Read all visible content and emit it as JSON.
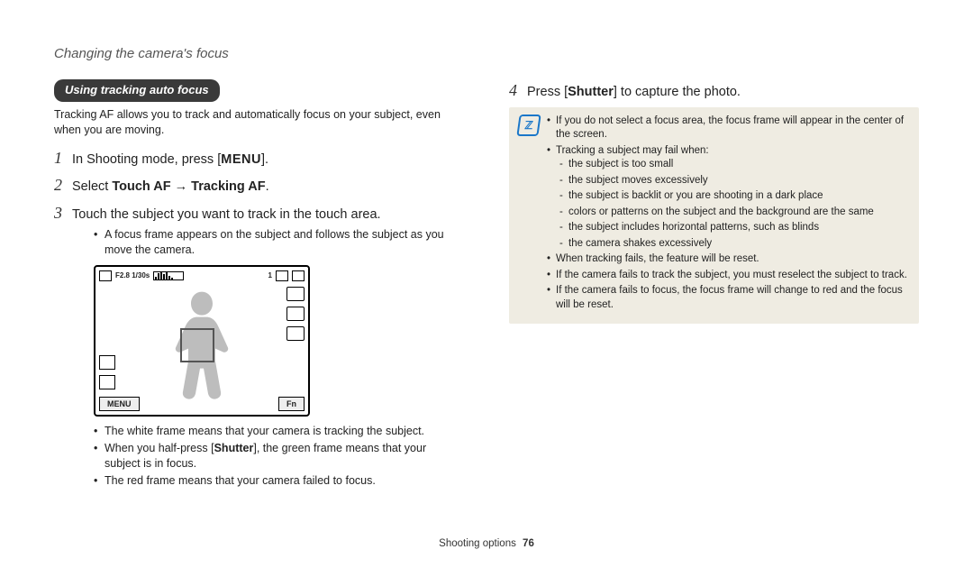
{
  "header": "Changing the camera's focus",
  "subheading": "Using tracking auto focus",
  "intro": "Tracking AF allows you to track and automatically focus on your subject, even when you are moving.",
  "steps": {
    "s1_pre": "In Shooting mode, press [",
    "s1_menu": "MENU",
    "s1_post": "].",
    "s2_pre": "Select ",
    "s2_bold": "Touch AF → Tracking AF",
    "s2_post": ".",
    "s3": "Touch the subject you want to track in the touch area.",
    "s3_sub": "A focus frame appears on the subject and follows the subject as you move the camera.",
    "s4_pre": "Press [",
    "s4_b": "Shutter",
    "s4_post": "] to capture the photo."
  },
  "lcd": {
    "fstop": "F2.8 1/30s",
    "count": "1",
    "menu": "MENU",
    "fn": "Fn"
  },
  "frame_notes": {
    "a": "The white frame means that your camera is tracking the subject.",
    "b_pre": "When you half-press [",
    "b_b": "Shutter",
    "b_post": "], the green frame means that your subject is in focus.",
    "c": "The red frame means that your camera failed to focus."
  },
  "note": {
    "items": {
      "n1": "If you do not select a focus area, the focus frame will appear in the center of the screen.",
      "n2": "Tracking a subject may fail when:",
      "n2s": {
        "a": "the subject is too small",
        "b": "the subject moves excessively",
        "c": "the subject is backlit or you are shooting in a dark place",
        "d": "colors or patterns on the subject and the background are the same",
        "e": "the subject includes horizontal patterns, such as blinds",
        "f": "the camera shakes excessively"
      },
      "n3": "When tracking fails, the feature will be reset.",
      "n4": "If the camera fails to track the subject, you must reselect the subject to track.",
      "n5": "If the camera fails to focus, the focus frame will change to red and the focus will be reset."
    }
  },
  "footer": {
    "section": "Shooting options",
    "page": "76"
  }
}
